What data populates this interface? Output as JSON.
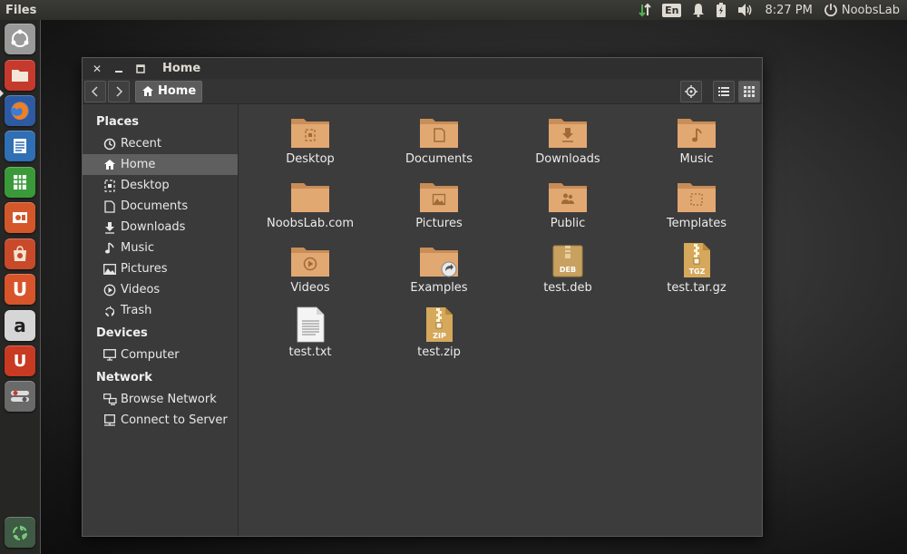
{
  "top_panel": {
    "app_title": "Files",
    "keyboard_layout": "En",
    "clock": "8:27 PM",
    "user": "NoobsLab"
  },
  "launcher": {
    "items": [
      {
        "name": "dash-home",
        "color": "#8a8a8a"
      },
      {
        "name": "files",
        "color": "#c63a2e"
      },
      {
        "name": "firefox",
        "color": "#e0642a"
      },
      {
        "name": "writer",
        "color": "#2f6fb3"
      },
      {
        "name": "calc",
        "color": "#3a9a3a"
      },
      {
        "name": "impress",
        "color": "#d4572a"
      },
      {
        "name": "software-center",
        "color": "#c84a2a"
      },
      {
        "name": "ubuntu-one",
        "color": "#d8542a"
      },
      {
        "name": "amazon",
        "color": "#c9c9c9"
      },
      {
        "name": "ubuntu-one-music",
        "color": "#c83a22"
      },
      {
        "name": "settings",
        "color": "#7a7a7a"
      },
      {
        "name": "trash",
        "color": "#4f6f55"
      }
    ]
  },
  "window": {
    "title": "Home",
    "breadcrumb": "Home"
  },
  "sidebar": {
    "places_heading": "Places",
    "places": [
      {
        "label": "Recent",
        "icon": "clock-icon"
      },
      {
        "label": "Home",
        "icon": "home-icon",
        "active": true
      },
      {
        "label": "Desktop",
        "icon": "desktop-icon"
      },
      {
        "label": "Documents",
        "icon": "document-icon"
      },
      {
        "label": "Downloads",
        "icon": "download-icon"
      },
      {
        "label": "Music",
        "icon": "music-icon"
      },
      {
        "label": "Pictures",
        "icon": "picture-icon"
      },
      {
        "label": "Videos",
        "icon": "video-icon"
      },
      {
        "label": "Trash",
        "icon": "trash-icon"
      }
    ],
    "devices_heading": "Devices",
    "devices": [
      {
        "label": "Computer",
        "icon": "computer-icon"
      }
    ],
    "network_heading": "Network",
    "network": [
      {
        "label": "Browse Network",
        "icon": "network-icon"
      },
      {
        "label": "Connect to Server",
        "icon": "server-icon"
      }
    ]
  },
  "files": [
    {
      "label": "Desktop",
      "kind": "folder",
      "emblem": "desktop"
    },
    {
      "label": "Documents",
      "kind": "folder",
      "emblem": "document"
    },
    {
      "label": "Downloads",
      "kind": "folder",
      "emblem": "download"
    },
    {
      "label": "Music",
      "kind": "folder",
      "emblem": "music"
    },
    {
      "label": "NoobsLab.com",
      "kind": "folder",
      "emblem": "none"
    },
    {
      "label": "Pictures",
      "kind": "folder",
      "emblem": "picture"
    },
    {
      "label": "Public",
      "kind": "folder",
      "emblem": "public"
    },
    {
      "label": "Templates",
      "kind": "folder",
      "emblem": "template"
    },
    {
      "label": "Videos",
      "kind": "folder",
      "emblem": "video"
    },
    {
      "label": "Examples",
      "kind": "folder-link",
      "emblem": "link"
    },
    {
      "label": "test.deb",
      "kind": "archive",
      "badge": "DEB"
    },
    {
      "label": "test.tar.gz",
      "kind": "archive",
      "badge": "TGZ"
    },
    {
      "label": "test.txt",
      "kind": "text"
    },
    {
      "label": "test.zip",
      "kind": "archive",
      "badge": "ZIP"
    }
  ],
  "colors": {
    "folder": "#e2a872",
    "folder_dark": "#c98d57",
    "archive": "#c8a060",
    "sidebar_active": "#5f5f5f"
  }
}
